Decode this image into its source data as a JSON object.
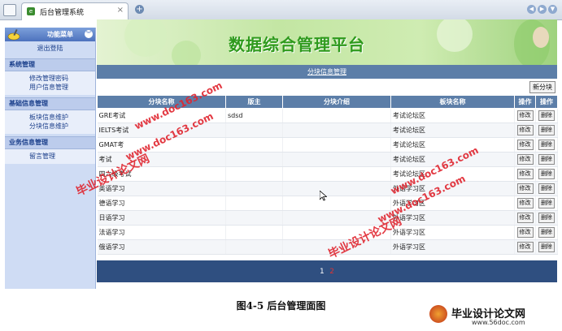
{
  "browser": {
    "tab_title": "后台管理系统",
    "tab_close": "×",
    "new_tab": "+",
    "nav": [
      "◀",
      "▶",
      "▼"
    ]
  },
  "sidebar": {
    "title": "功能菜单",
    "collapse": "☼",
    "logout": "退出登陆",
    "groups": [
      {
        "title": "系统管理",
        "items": [
          "修改管理密码",
          "用户信息管理"
        ]
      },
      {
        "title": "基础信息管理",
        "items": [
          "板块信息维护",
          "分块信息维护"
        ]
      },
      {
        "title": "业务信息管理",
        "items": [
          "留言管理"
        ]
      }
    ]
  },
  "banner": {
    "title": "数据综合管理平台"
  },
  "section": {
    "title": "分块信息管理"
  },
  "toolbar": {
    "add_label": "新分块"
  },
  "table": {
    "headers": [
      "分块名称",
      "版主",
      "分块介绍",
      "板块名称",
      "操作",
      "操作"
    ],
    "edit_label": "修改",
    "delete_label": "删除",
    "rows": [
      {
        "name": "GRE考试",
        "moderator": "sdsd",
        "intro": "",
        "board": "考试论坛区"
      },
      {
        "name": "IELTS考试",
        "moderator": "",
        "intro": "",
        "board": "考试论坛区"
      },
      {
        "name": "GMAT考",
        "moderator": "",
        "intro": "",
        "board": "考试论坛区"
      },
      {
        "name": "考试",
        "moderator": "",
        "intro": "",
        "board": "考试论坛区"
      },
      {
        "name": "四六级考试",
        "moderator": "",
        "intro": "",
        "board": "考试论坛区"
      },
      {
        "name": "英语学习",
        "moderator": "",
        "intro": "",
        "board": "外语学习区"
      },
      {
        "name": "德语学习",
        "moderator": "",
        "intro": "",
        "board": "外语学习区"
      },
      {
        "name": "日语学习",
        "moderator": "",
        "intro": "",
        "board": "外语学习区"
      },
      {
        "name": "法语学习",
        "moderator": "",
        "intro": "",
        "board": "外语学习区"
      },
      {
        "name": "俄语学习",
        "moderator": "",
        "intro": "",
        "board": "外语学习区"
      }
    ]
  },
  "pager": {
    "current": "1",
    "next": "2"
  },
  "caption": "图4-5 后台管理面图",
  "watermarks": [
    "毕业设计论文网",
    "www.doc163.com"
  ],
  "footer": {
    "brand": "毕业设计论文网",
    "url": "www.56doc.com"
  },
  "colors": {
    "accent": "#5c7ea8",
    "banner_text": "#2e9a1c",
    "watermark": "#e0252f"
  }
}
